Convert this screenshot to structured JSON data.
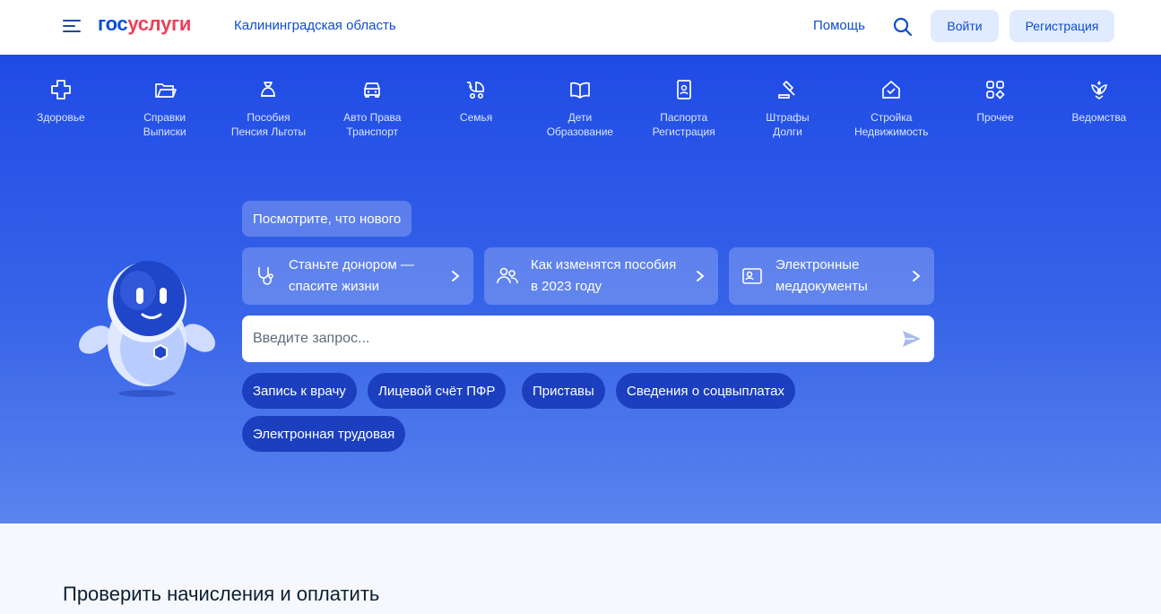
{
  "header": {
    "logo_part1": "гос",
    "logo_part2": "услуги",
    "region": "Калининградская область",
    "help": "Помощь",
    "login": "Войти",
    "register": "Регистрация"
  },
  "categories": [
    {
      "line1": "Здоровье",
      "line2": "",
      "icon": "health-cross-icon"
    },
    {
      "line1": "Справки",
      "line2": "Выписки",
      "icon": "folder-icon"
    },
    {
      "line1": "Пособия",
      "line2": "Пенсия Льготы",
      "icon": "money-bag-icon"
    },
    {
      "line1": "Авто Права",
      "line2": "Транспорт",
      "icon": "car-icon"
    },
    {
      "line1": "Семья",
      "line2": "",
      "icon": "stroller-icon"
    },
    {
      "line1": "Дети",
      "line2": "Образование",
      "icon": "book-icon"
    },
    {
      "line1": "Паспорта",
      "line2": "Регистрация",
      "icon": "passport-icon"
    },
    {
      "line1": "Штрафы",
      "line2": "Долги",
      "icon": "gavel-icon"
    },
    {
      "line1": "Стройка",
      "line2": "Недвижимость",
      "icon": "house-icon"
    },
    {
      "line1": "Прочее",
      "line2": "",
      "icon": "grid-icon"
    },
    {
      "line1": "Ведомства",
      "line2": "",
      "icon": "coat-of-arms-icon"
    }
  ],
  "hero": {
    "news_chip": "Посмотрите, что нового",
    "cards": [
      {
        "line1": "Станьте донором —",
        "line2": "спасите жизни",
        "icon": "stethoscope-icon"
      },
      {
        "line1": "Как изменятся пособия",
        "line2": "в 2023 году",
        "icon": "people-icon"
      },
      {
        "line1": "Электронные",
        "line2": "меддокументы",
        "icon": "id-card-icon"
      }
    ],
    "search_placeholder": "Введите запрос...",
    "quick_tags": [
      "Запись к врачу",
      "Лицевой счёт ПФР",
      "Приставы",
      "Сведения о соцвыплатах",
      "Электронная трудовая"
    ]
  },
  "section": {
    "title": "Проверить начисления и оплатить"
  },
  "colors": {
    "brand_blue": "#0d4cd3",
    "brand_red": "#ee3f58",
    "hero_top": "#1f4be6",
    "hero_bottom": "#5a84ee"
  }
}
